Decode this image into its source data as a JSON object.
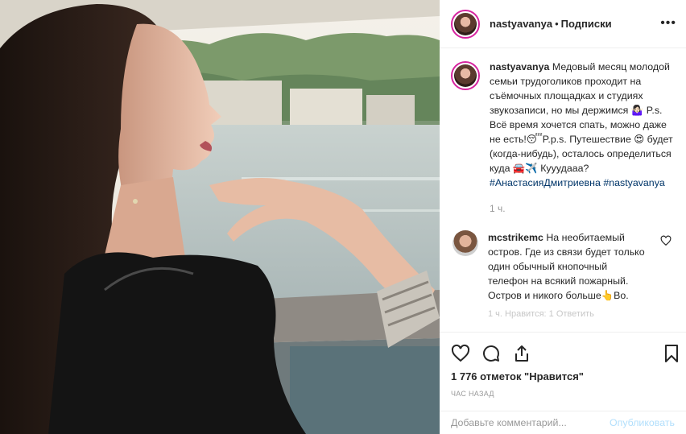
{
  "post": {
    "username": "nastyavanya",
    "separator": "•",
    "follow_label": "Подписки",
    "more_icon": "•••"
  },
  "caption": {
    "username": "nastyavanya",
    "text": "Медовый месяц молодой семьи трудоголиков проходит на съёмочных площадках и студиях звукозаписи, но мы держимся 🤷🏻‍♀️ P.s. Всё время хочется спать, можно даже не есть!😴P.p.s. Путешествие 😍 будет (когда-нибудь), осталось определиться куда 🚘✈️ Кууудааа?",
    "hashtag1": "#АнастасияДмитриевна",
    "hashtag2": "#nastyavanya",
    "time": "1 ч."
  },
  "comment": {
    "username": "mcstrikemc",
    "text": "На необитаемый остров. Где из связи будет только один обычный кнопочный телефон на всякий пожарный. Остров и никого больше👆Во.",
    "meta_faded": "1 ч.   Нравится: 1   Ответить"
  },
  "likes_text": "1 776 отметок \"Нравится\"",
  "ago_text": "ЧАС НАЗАД",
  "add_comment": {
    "placeholder": "Добавьте комментарий...",
    "post_label": "Опубликовать"
  },
  "colors": {
    "link": "#003569",
    "post_disabled": "#b2dffc",
    "story_ring": "#d6249f"
  }
}
